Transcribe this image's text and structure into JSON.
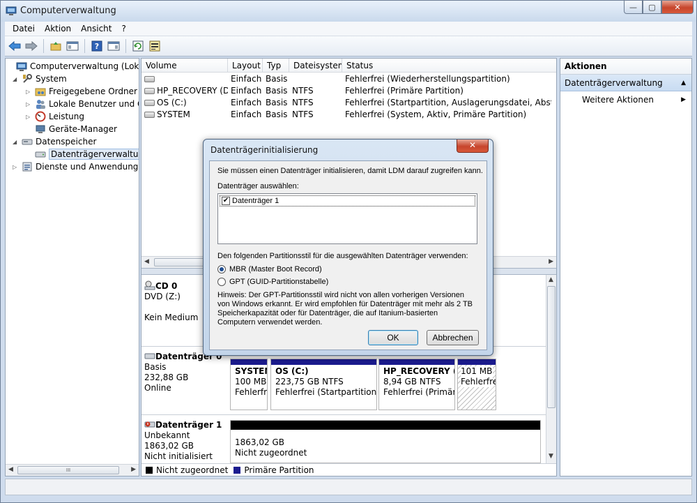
{
  "window": {
    "title": "Computerverwaltung",
    "buttons": {
      "minimize": "—",
      "maximize": "▢",
      "close": "✕"
    }
  },
  "menu": [
    "Datei",
    "Aktion",
    "Ansicht",
    "?"
  ],
  "tree": {
    "items": [
      {
        "label": "Computerverwaltung (Lokal)",
        "expander": ""
      },
      {
        "label": "System",
        "expander": "◢"
      },
      {
        "label": "Freigegebene Ordner",
        "expander": "▷"
      },
      {
        "label": "Lokale Benutzer und Gr",
        "expander": "▷"
      },
      {
        "label": "Leistung",
        "expander": "▷"
      },
      {
        "label": "Geräte-Manager",
        "expander": ""
      },
      {
        "label": "Datenspeicher",
        "expander": "◢"
      },
      {
        "label": "Datenträgerverwaltung",
        "expander": ""
      },
      {
        "label": "Dienste und Anwendungen",
        "expander": "▷"
      }
    ],
    "scroll_thumb": "III"
  },
  "volume_list": {
    "headers": [
      "Volume",
      "Layout",
      "Typ",
      "Dateisystem",
      "Status"
    ],
    "rows": [
      {
        "volume": "",
        "layout": "Einfach",
        "typ": "Basis",
        "fs": "",
        "status": "Fehlerfrei (Wiederherstellungspartition)"
      },
      {
        "volume": "HP_RECOVERY (D:)",
        "layout": "Einfach",
        "typ": "Basis",
        "fs": "NTFS",
        "status": "Fehlerfrei (Primäre Partition)"
      },
      {
        "volume": "OS (C:)",
        "layout": "Einfach",
        "typ": "Basis",
        "fs": "NTFS",
        "status": "Fehlerfrei (Startpartition, Auslagerungsdatei, Absturzabbi"
      },
      {
        "volume": "SYSTEM",
        "layout": "Einfach",
        "typ": "Basis",
        "fs": "NTFS",
        "status": "Fehlerfrei (System, Aktiv, Primäre Partition)"
      }
    ]
  },
  "disks": {
    "cd0": {
      "name": "CD 0",
      "line1": "DVD (Z:)",
      "line2": "Kein Medium"
    },
    "disk0": {
      "name": "Datenträger 0",
      "type": "Basis",
      "size": "232,88 GB",
      "state": "Online",
      "partitions": [
        {
          "name": "SYSTEM",
          "size": "100 MB",
          "status": "Fehlerfrei"
        },
        {
          "name": "OS  (C:)",
          "size": "223,75 GB NTFS",
          "status": "Fehlerfrei (Startpartition, A"
        },
        {
          "name": "HP_RECOVERY  (D",
          "size": "8,94 GB NTFS",
          "status": "Fehlerfrei (Primäre"
        },
        {
          "name": "",
          "size": "101 MB",
          "status": "Fehlerfrei"
        }
      ]
    },
    "disk1": {
      "name": "Datenträger 1",
      "type": "Unbekannt",
      "size": "1863,02 GB",
      "state": "Nicht initialisiert",
      "space_size": "1863,02 GB",
      "space_state": "Nicht zugeordnet"
    }
  },
  "legend": [
    {
      "label": "Nicht zugeordnet",
      "color": "#000000"
    },
    {
      "label": "Primäre Partition",
      "color": "#1b1b8f"
    }
  ],
  "actions": {
    "header": "Aktionen",
    "section": "Datenträgerverwaltung",
    "item": "Weitere Aktionen"
  },
  "dialog": {
    "title": "Datenträgerinitialisierung",
    "intro": "Sie müssen einen Datenträger initialisieren, damit LDM darauf zugreifen kann.",
    "select_label": "Datenträger auswählen:",
    "disk_item": "Datenträger 1",
    "disk_checked": true,
    "style_label": "Den folgenden Partitionsstil für die ausgewählten Datenträger verwenden:",
    "option_mbr": "MBR (Master Boot Record)",
    "option_gpt": "GPT (GUID-Partitionstabelle)",
    "selected_option": "MBR",
    "note": "Hinweis: Der GPT-Partitionsstil wird nicht von allen vorherigen Versionen von Windows erkannt. Er wird empfohlen für Datenträger mit mehr als 2 TB Speicherkapazität oder für Datenträger, die auf Itanium-basierten Computern verwendet werden.",
    "ok": "OK",
    "cancel": "Abbrechen"
  }
}
